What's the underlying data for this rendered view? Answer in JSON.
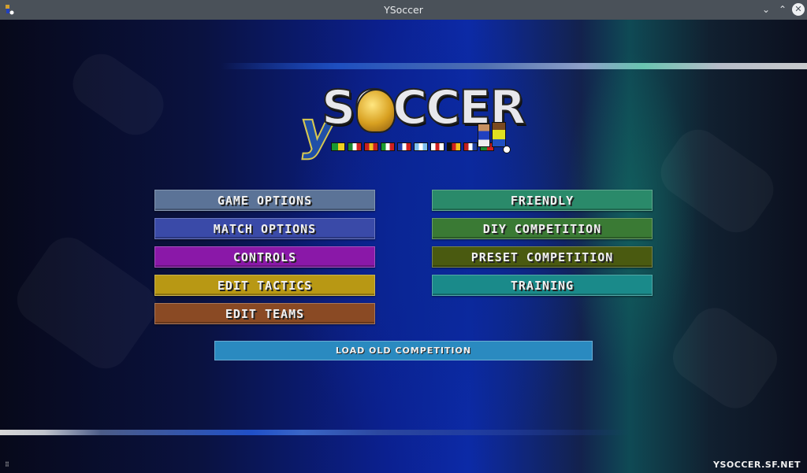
{
  "window": {
    "title": "YSoccer",
    "icons": {
      "app": "ysoccer-app-icon",
      "minimize": "chevron-down-icon",
      "maximize": "chevron-up-icon",
      "close": "close-icon"
    },
    "minimize_glyph": "⌄",
    "maximize_glyph": "⌃",
    "close_glyph": "✕"
  },
  "logo": {
    "prefix": "y",
    "word": "SOCCER",
    "flags": [
      {
        "name": "brazil",
        "colors": [
          "#1a9a30",
          "#f0d020"
        ]
      },
      {
        "name": "mexico",
        "colors": [
          "#1a8a30",
          "#ffffff",
          "#d02020"
        ]
      },
      {
        "name": "spain",
        "colors": [
          "#c82020",
          "#f0c020",
          "#c82020"
        ]
      },
      {
        "name": "italy",
        "colors": [
          "#1a9a30",
          "#ffffff",
          "#d02020"
        ]
      },
      {
        "name": "france",
        "colors": [
          "#2040b0",
          "#ffffff",
          "#d02020"
        ]
      },
      {
        "name": "argentina",
        "colors": [
          "#80c0f0",
          "#ffffff",
          "#80c0f0"
        ]
      },
      {
        "name": "england",
        "colors": [
          "#ffffff",
          "#d02020",
          "#ffffff"
        ]
      },
      {
        "name": "germany",
        "colors": [
          "#111111",
          "#d02020",
          "#f0c020"
        ]
      },
      {
        "name": "netherlands",
        "colors": [
          "#c02020",
          "#ffffff",
          "#2040a0"
        ]
      },
      {
        "name": "portugal",
        "colors": [
          "#1a8a30",
          "#d02020"
        ]
      }
    ]
  },
  "menu": {
    "left": [
      {
        "label": "GAME OPTIONS",
        "color": "#5b7397"
      },
      {
        "label": "MATCH OPTIONS",
        "color": "#3a4aa8"
      },
      {
        "label": "CONTROLS",
        "color": "#8a18a8"
      },
      {
        "label": "EDIT TACTICS",
        "color": "#b89814"
      },
      {
        "label": "EDIT TEAMS",
        "color": "#8a4a24"
      }
    ],
    "right": [
      {
        "label": "FRIENDLY",
        "color": "#2a8a6a"
      },
      {
        "label": "DIY COMPETITION",
        "color": "#3a7a34"
      },
      {
        "label": "PRESET COMPETITION",
        "color": "#4a5a10"
      },
      {
        "label": "TRAINING",
        "color": "#1a8a8a"
      }
    ],
    "load": {
      "label": "LOAD OLD COMPETITION",
      "color": "#2a8ac0"
    }
  },
  "footer": {
    "site": "YSOCCER.SF.NET"
  }
}
